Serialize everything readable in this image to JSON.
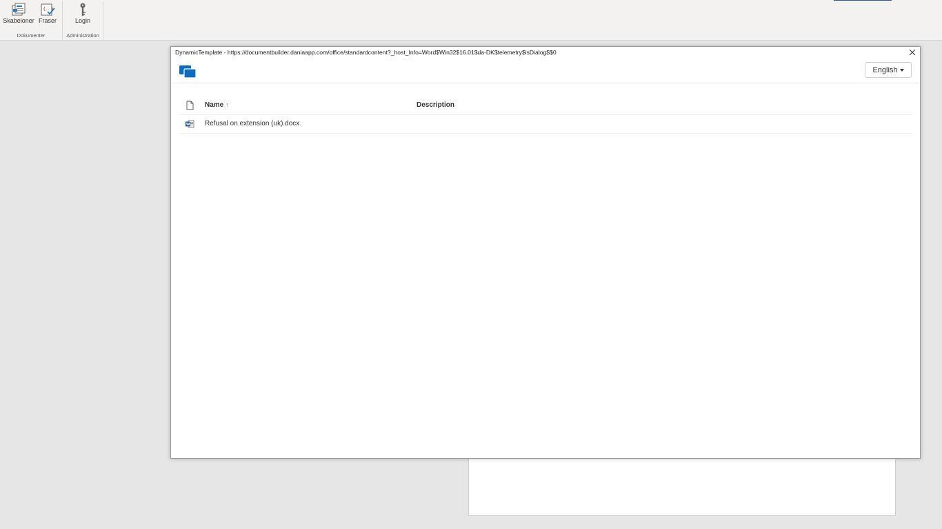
{
  "ribbon": {
    "buttons": {
      "skabeloner": "Skabeloner",
      "fraser": "Fraser",
      "login": "Login"
    },
    "groups": {
      "dokumenter": "Dokumenter",
      "administration": "Administration"
    }
  },
  "dialog": {
    "title": "DynamicTemplate - https://documentbuilder.daniaapp.com/office/standardcontent?_host_Info=Word$Win32$16.01$da-DK$telemetry$isDialog$$0",
    "language": "English",
    "table": {
      "columns": {
        "name": "Name",
        "sort_indicator": "↑",
        "description": "Description"
      },
      "rows": [
        {
          "name": "Refusal on extension (uk).docx",
          "description": ""
        }
      ]
    }
  },
  "colors": {
    "accent": "#0f6cbd",
    "word_blue": "#2b579a"
  },
  "icons": [
    "templates-icon",
    "phrases-icon",
    "key-icon",
    "close-icon",
    "app-logo-icon",
    "document-icon",
    "word-document-icon",
    "chevron-down-icon"
  ]
}
